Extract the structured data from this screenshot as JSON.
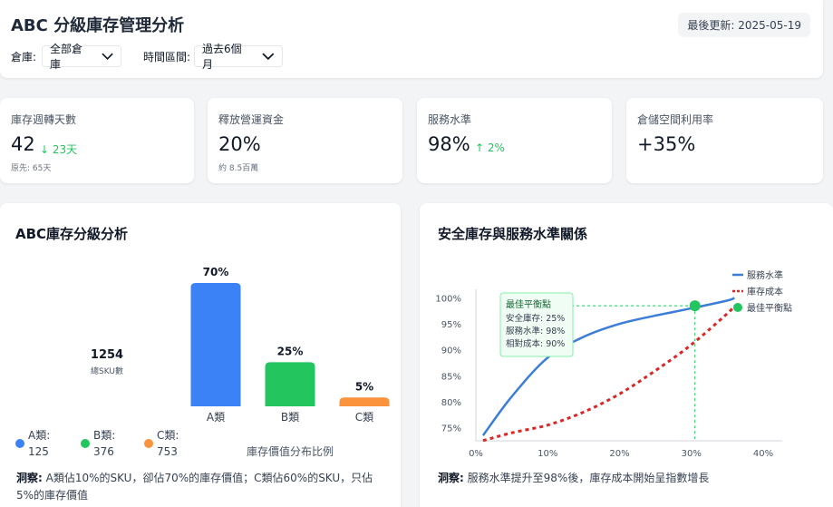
{
  "header": {
    "title": "ABC 分級庫存管理分析",
    "updated": "最後更新: 2025-05-19",
    "warehouse_label": "倉庫:",
    "warehouse_value": "全部倉庫",
    "period_label": "時間區間:",
    "period_value": "過去6個月"
  },
  "kpis": [
    {
      "title": "庫存週轉天數",
      "value": "42",
      "delta": "↓ 23天",
      "sub": "原先: 65天"
    },
    {
      "title": "釋放營運資金",
      "value": "20%",
      "delta": "",
      "sub": "約 8.5百萬"
    },
    {
      "title": "服務水準",
      "value": "98%",
      "delta": "↑ 2%",
      "sub": ""
    },
    {
      "title": "倉儲空間利用率",
      "value": "+35%",
      "delta": "",
      "sub": ""
    }
  ],
  "abc": {
    "title": "ABC庫存分級分析",
    "total_value": "1254",
    "total_label": "總SKU數",
    "axis_caption": "庫存價值分布比例",
    "legend": [
      {
        "label": "A類:",
        "count": "125",
        "color": "#3b82f6"
      },
      {
        "label": "B類:",
        "count": "376",
        "color": "#22c55e"
      },
      {
        "label": "C類:",
        "count": "753",
        "color": "#fb923c"
      }
    ],
    "insight_label": "洞察:",
    "insight_text": "A類佔10%的SKU，卻佔70%的庫存價值；C類佔60%的SKU，只佔5%的庫存價值"
  },
  "safety": {
    "title": "安全庫存與服務水準關係",
    "legend": [
      {
        "label": "服務水準",
        "color": "#3b7dd8"
      },
      {
        "label": "庫存成本",
        "color": "#dc2626"
      },
      {
        "label": "最佳平衡點",
        "color": "#22c55e"
      }
    ],
    "tooltip": {
      "title": "最佳平衡點",
      "lines": [
        "安全庫存: 25%",
        "服務水準: 98%",
        "相對成本: 90%"
      ]
    },
    "insight_label": "洞察:",
    "insight_text": "服務水準提升至98%後，庫存成本開始呈指數增長"
  },
  "chart_data": [
    {
      "type": "bar",
      "title": "ABC庫存分級分析",
      "xlabel": "庫存價值分布比例",
      "categories": [
        "A類",
        "B類",
        "C類"
      ],
      "values": [
        70,
        25,
        5
      ],
      "value_labels": [
        "70%",
        "25%",
        "5%"
      ],
      "colors": [
        "#3b82f6",
        "#22c55e",
        "#fb923c"
      ],
      "ylim": [
        0,
        70
      ]
    },
    {
      "type": "line",
      "title": "安全庫存與服務水準關係",
      "x_ticks": [
        "0%",
        "10%",
        "20%",
        "30%",
        "40%"
      ],
      "y_ticks": [
        "75%",
        "80%",
        "85%",
        "90%",
        "95%",
        "100%"
      ],
      "xlim": [
        0,
        40
      ],
      "ylim": [
        72.5,
        100.5
      ],
      "series": [
        {
          "name": "服務水準",
          "x": [
            1,
            5,
            10,
            15,
            20,
            25,
            30,
            35,
            36
          ],
          "y": [
            73.5,
            81,
            88.5,
            92.5,
            95,
            96.6,
            98,
            99.5,
            100
          ],
          "style": "solid",
          "color": "#3b7dd8"
        },
        {
          "name": "庫存成本",
          "x": [
            1,
            5,
            10,
            15,
            20,
            25,
            30,
            35,
            36
          ],
          "y": [
            72.5,
            74,
            75.5,
            78,
            81.5,
            86,
            91,
            97,
            98.5
          ],
          "style": "dashed",
          "color": "#dc2626"
        }
      ],
      "marker": {
        "name": "最佳平衡點",
        "x": 30.5,
        "y": 98.5,
        "color": "#22c55e"
      },
      "legend_position": "top-right",
      "grid": false
    }
  ]
}
